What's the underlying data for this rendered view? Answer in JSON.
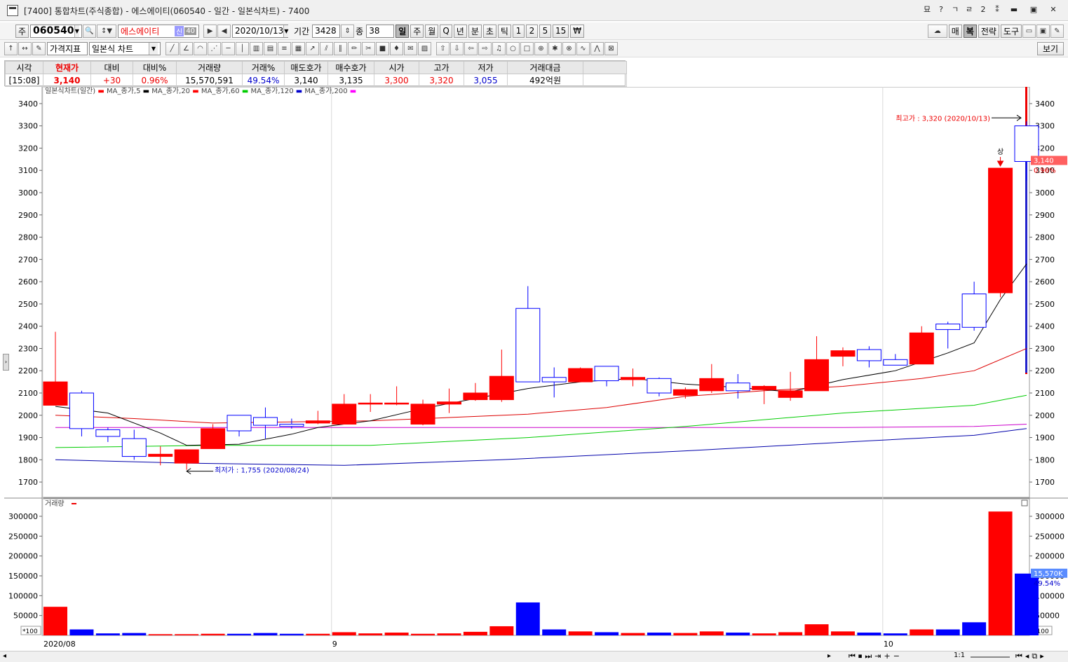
{
  "window": {
    "title": "[7400] 통합차트(주식종합) - 에스에이티(060540 - 일간 - 일본식차트) - 7400",
    "right_icons": [
      "묘",
      "?",
      "ㄱ",
      "ㄹ",
      "2",
      "⁑"
    ]
  },
  "toolbar1": {
    "code_prefix": "주",
    "code": "060540",
    "name": "에스에이티",
    "badge1": "신",
    "badge2": "40",
    "date": "2020/10/13",
    "period_label": "기간",
    "period": "3428",
    "count_label": "종",
    "count": "38",
    "periods": [
      "일",
      "주",
      "월",
      "Q",
      "년",
      "분",
      "초",
      "틱",
      "1",
      "2",
      "5",
      "15",
      "₩"
    ],
    "right_buttons": [
      "매",
      "복",
      "전략",
      "도구"
    ]
  },
  "toolbar2": {
    "indicator": "가격지표",
    "chart_type": "일본식 차트",
    "view": "보기"
  },
  "quote": {
    "headers": [
      "시각",
      "현재가",
      "대비",
      "대비%",
      "거래량",
      "거래%",
      "매도호가",
      "매수호가",
      "시가",
      "고가",
      "저가",
      "거래대금"
    ],
    "values": [
      "[15:08]",
      "3,140",
      "+30",
      "0.96%",
      "15,570,591",
      "49.54%",
      "3,140",
      "3,135",
      "3,300",
      "3,320",
      "3,055",
      "492억원"
    ]
  },
  "chart_data": {
    "type": "candlestick",
    "title": "일본식차트(일간)",
    "legend": [
      {
        "name": "MA_종가,5",
        "color": "#000000"
      },
      {
        "name": "MA_종가,20",
        "color": "#ff0000"
      },
      {
        "name": "MA_종가,60",
        "color": "#00cc00"
      },
      {
        "name": "MA_종가,120",
        "color": "#0000cc"
      },
      {
        "name": "MA_종가,200",
        "color": "#ff00ff"
      }
    ],
    "ylim": [
      1650,
      3450
    ],
    "yticks": [
      1700,
      1800,
      1900,
      2000,
      2100,
      2200,
      2300,
      2400,
      2500,
      2600,
      2700,
      2800,
      2900,
      3000,
      3100,
      3200,
      3300,
      3400
    ],
    "x_labels": [
      {
        "i": 0,
        "text": "2020/08"
      },
      {
        "i": 11,
        "text": "9"
      },
      {
        "i": 32,
        "text": "10"
      }
    ],
    "candles": [
      {
        "o": 2045,
        "h": 2375,
        "l": 2045,
        "c": 2150
      },
      {
        "o": 2100,
        "h": 2110,
        "l": 1905,
        "c": 1940
      },
      {
        "o": 1935,
        "h": 1945,
        "l": 1880,
        "c": 1905
      },
      {
        "o": 1895,
        "h": 1935,
        "l": 1800,
        "c": 1815
      },
      {
        "o": 1815,
        "h": 1860,
        "l": 1775,
        "c": 1825
      },
      {
        "o": 1785,
        "h": 1840,
        "l": 1755,
        "c": 1845
      },
      {
        "o": 1850,
        "h": 1960,
        "l": 1850,
        "c": 1940
      },
      {
        "o": 2000,
        "h": 2000,
        "l": 1905,
        "c": 1930
      },
      {
        "o": 1990,
        "h": 2035,
        "l": 1895,
        "c": 1955
      },
      {
        "o": 1960,
        "h": 1985,
        "l": 1940,
        "c": 1950
      },
      {
        "o": 1965,
        "h": 2020,
        "l": 1960,
        "c": 1975
      },
      {
        "o": 1960,
        "h": 2095,
        "l": 1960,
        "c": 2050
      },
      {
        "o": 2050,
        "h": 2095,
        "l": 2015,
        "c": 2055
      },
      {
        "o": 2050,
        "h": 2130,
        "l": 2045,
        "c": 2055
      },
      {
        "o": 1960,
        "h": 2070,
        "l": 1955,
        "c": 2050
      },
      {
        "o": 2050,
        "h": 2120,
        "l": 2010,
        "c": 2060
      },
      {
        "o": 2070,
        "h": 2145,
        "l": 2065,
        "c": 2100
      },
      {
        "o": 2070,
        "h": 2295,
        "l": 2060,
        "c": 2175
      },
      {
        "o": 2480,
        "h": 2580,
        "l": 2150,
        "c": 2150
      },
      {
        "o": 2170,
        "h": 2215,
        "l": 2080,
        "c": 2150
      },
      {
        "o": 2150,
        "h": 2215,
        "l": 2150,
        "c": 2210
      },
      {
        "o": 2220,
        "h": 2220,
        "l": 2130,
        "c": 2155
      },
      {
        "o": 2160,
        "h": 2210,
        "l": 2130,
        "c": 2170
      },
      {
        "o": 2165,
        "h": 2170,
        "l": 2085,
        "c": 2100
      },
      {
        "o": 2090,
        "h": 2125,
        "l": 2075,
        "c": 2115
      },
      {
        "o": 2110,
        "h": 2230,
        "l": 2100,
        "c": 2165
      },
      {
        "o": 2145,
        "h": 2185,
        "l": 2075,
        "c": 2110
      },
      {
        "o": 2115,
        "h": 2135,
        "l": 2050,
        "c": 2130
      },
      {
        "o": 2080,
        "h": 2195,
        "l": 2065,
        "c": 2110
      },
      {
        "o": 2110,
        "h": 2355,
        "l": 2110,
        "c": 2250
      },
      {
        "o": 2265,
        "h": 2305,
        "l": 2220,
        "c": 2290
      },
      {
        "o": 2295,
        "h": 2310,
        "l": 2215,
        "c": 2245
      },
      {
        "o": 2250,
        "h": 2275,
        "l": 2225,
        "c": 2225
      },
      {
        "o": 2230,
        "h": 2400,
        "l": 2230,
        "c": 2370
      },
      {
        "o": 2410,
        "h": 2420,
        "l": 2300,
        "c": 2385
      },
      {
        "o": 2545,
        "h": 2600,
        "l": 2380,
        "c": 2395
      },
      {
        "o": 2550,
        "h": 3110,
        "l": 2530,
        "c": 3110
      },
      {
        "o": 3300,
        "h": 3320,
        "l": 3055,
        "c": 3140
      }
    ],
    "ma5": [
      [
        0,
        2040
      ],
      [
        2,
        2010
      ],
      [
        4,
        1920
      ],
      [
        5,
        1865
      ],
      [
        7,
        1870
      ],
      [
        9,
        1915
      ],
      [
        10,
        1945
      ],
      [
        12,
        1975
      ],
      [
        14,
        2030
      ],
      [
        16,
        2075
      ],
      [
        18,
        2120
      ],
      [
        20,
        2150
      ],
      [
        22,
        2165
      ],
      [
        24,
        2140
      ],
      [
        26,
        2125
      ],
      [
        28,
        2105
      ],
      [
        30,
        2160
      ],
      [
        32,
        2200
      ],
      [
        34,
        2280
      ],
      [
        35,
        2325
      ],
      [
        36,
        2520
      ],
      [
        37,
        2680
      ]
    ],
    "ma20": [
      [
        0,
        2000
      ],
      [
        3,
        1985
      ],
      [
        6,
        1965
      ],
      [
        9,
        1970
      ],
      [
        12,
        1975
      ],
      [
        15,
        1990
      ],
      [
        18,
        2005
      ],
      [
        21,
        2035
      ],
      [
        24,
        2085
      ],
      [
        27,
        2110
      ],
      [
        30,
        2130
      ],
      [
        33,
        2165
      ],
      [
        35,
        2200
      ],
      [
        37,
        2300
      ]
    ],
    "ma60": [
      [
        0,
        1855
      ],
      [
        6,
        1865
      ],
      [
        12,
        1865
      ],
      [
        18,
        1900
      ],
      [
        24,
        1950
      ],
      [
        30,
        2010
      ],
      [
        35,
        2045
      ],
      [
        37,
        2090
      ]
    ],
    "ma120": [
      [
        0,
        1800
      ],
      [
        5,
        1785
      ],
      [
        11,
        1775
      ],
      [
        17,
        1800
      ],
      [
        24,
        1840
      ],
      [
        31,
        1885
      ],
      [
        35,
        1910
      ],
      [
        37,
        1940
      ]
    ],
    "ma200": [
      [
        0,
        1945
      ],
      [
        10,
        1945
      ],
      [
        20,
        1945
      ],
      [
        30,
        1945
      ],
      [
        35,
        1950
      ],
      [
        37,
        1960
      ]
    ],
    "annotations": {
      "high": "최고가 : 3,320 (2020/10/13)",
      "low": "최저가 : 1,755 (2020/08/24)",
      "limit_up": "상"
    },
    "price_tag": {
      "price": "3,140",
      "pct": "0.96%"
    },
    "volume": {
      "title": "거래량",
      "ylim": [
        0,
        330000
      ],
      "yticks": [
        50000,
        100000,
        150000,
        200000,
        250000,
        300000
      ],
      "unit_label": "*100",
      "tag_value": "15,570K",
      "tag_pct": "49.54%",
      "values": [
        72000,
        15000,
        5000,
        6000,
        3000,
        3000,
        4000,
        4000,
        6000,
        4000,
        4000,
        8000,
        5000,
        7000,
        4000,
        5000,
        9000,
        23000,
        83000,
        15000,
        10000,
        8000,
        6000,
        7000,
        6000,
        10000,
        7000,
        5000,
        8000,
        28000,
        10000,
        7000,
        5000,
        15000,
        15000,
        33000,
        312000,
        155700
      ]
    }
  }
}
